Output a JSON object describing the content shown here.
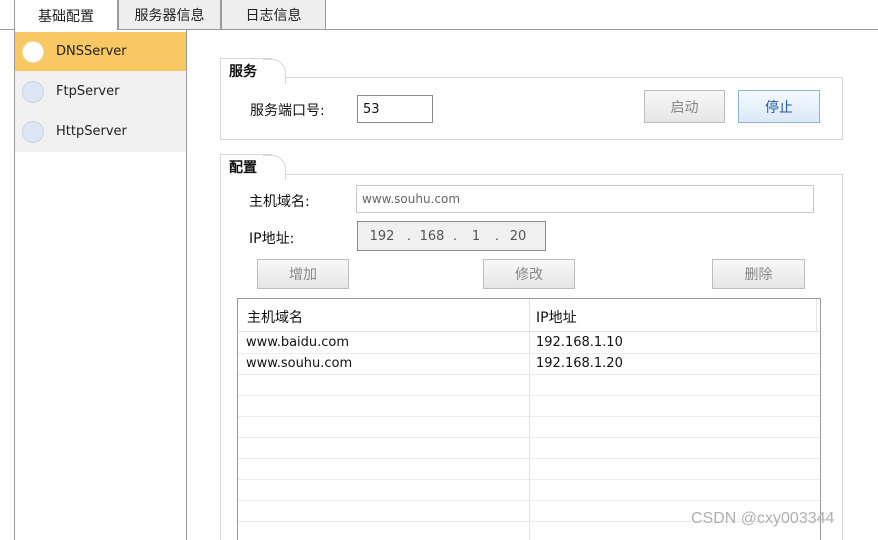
{
  "tabs": [
    {
      "label": "基础配置",
      "active": true
    },
    {
      "label": "服务器信息",
      "active": false
    },
    {
      "label": "日志信息",
      "active": false
    }
  ],
  "servers": [
    {
      "label": "DNSServer",
      "selected": true
    },
    {
      "label": "FtpServer",
      "selected": false
    },
    {
      "label": "HttpServer",
      "selected": false
    }
  ],
  "service": {
    "title": "服务",
    "port_label": "服务端口号:",
    "port_value": "53",
    "start_label": "启动",
    "stop_label": "停止"
  },
  "config": {
    "title": "配置",
    "host_label": "主机域名:",
    "host_value": "www.souhu.com",
    "ip_label": "IP地址:",
    "ip_segments": [
      "192",
      "168",
      "1",
      "20"
    ],
    "ip_separator": ".",
    "add_label": "增加",
    "edit_label": "修改",
    "delete_label": "删除"
  },
  "table": {
    "columns": [
      "主机域名",
      "IP地址"
    ],
    "rows": [
      [
        "www.baidu.com",
        "192.168.1.10"
      ],
      [
        "www.souhu.com",
        "192.168.1.20"
      ]
    ]
  },
  "watermark": "CSDN @cxy003344",
  "colors": {
    "selected_item": "#f9c862",
    "primary_button_text": "#245a9e"
  }
}
